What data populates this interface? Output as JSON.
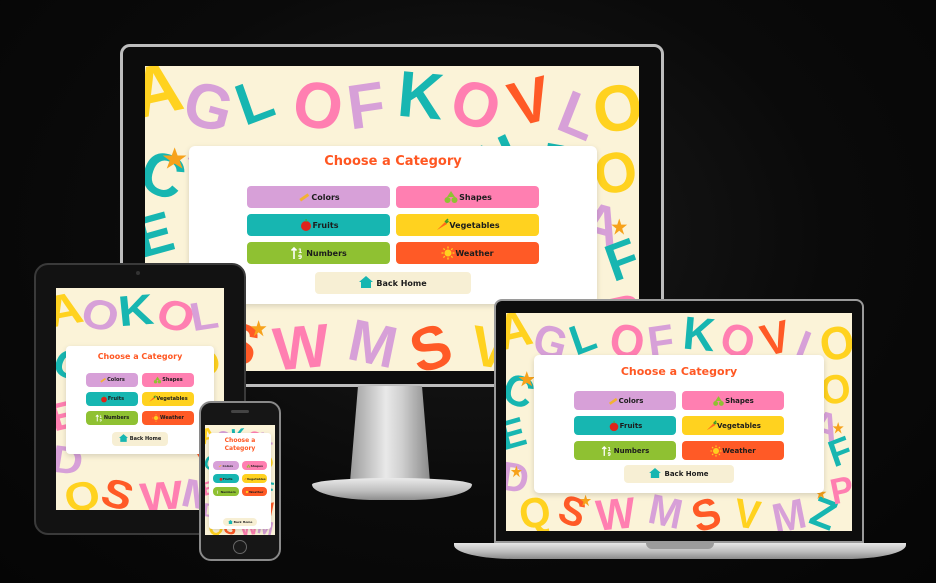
{
  "card": {
    "title": "Choose a Category",
    "title_phone_line1": "Choose a",
    "title_phone_line2": "Category",
    "back_home": "Back Home"
  },
  "categories": [
    {
      "label": "Colors",
      "icon": "pencil-icon",
      "color": "#d7a0d8"
    },
    {
      "label": "Shapes",
      "icon": "shapes-icon",
      "color": "#ff7fb1"
    },
    {
      "label": "Fruits",
      "icon": "apple-icon",
      "color": "#17b6b1"
    },
    {
      "label": "Vegetables",
      "icon": "carrot-icon",
      "color": "#ffd21f"
    },
    {
      "label": "Numbers",
      "icon": "numbers-icon",
      "color": "#8fc132"
    },
    {
      "label": "Weather",
      "icon": "sun-icon",
      "color": "#ff5a26"
    }
  ],
  "colors": {
    "accent": "#ff5722",
    "background": "#fbf3d8",
    "home_button": "#f7efd4"
  }
}
